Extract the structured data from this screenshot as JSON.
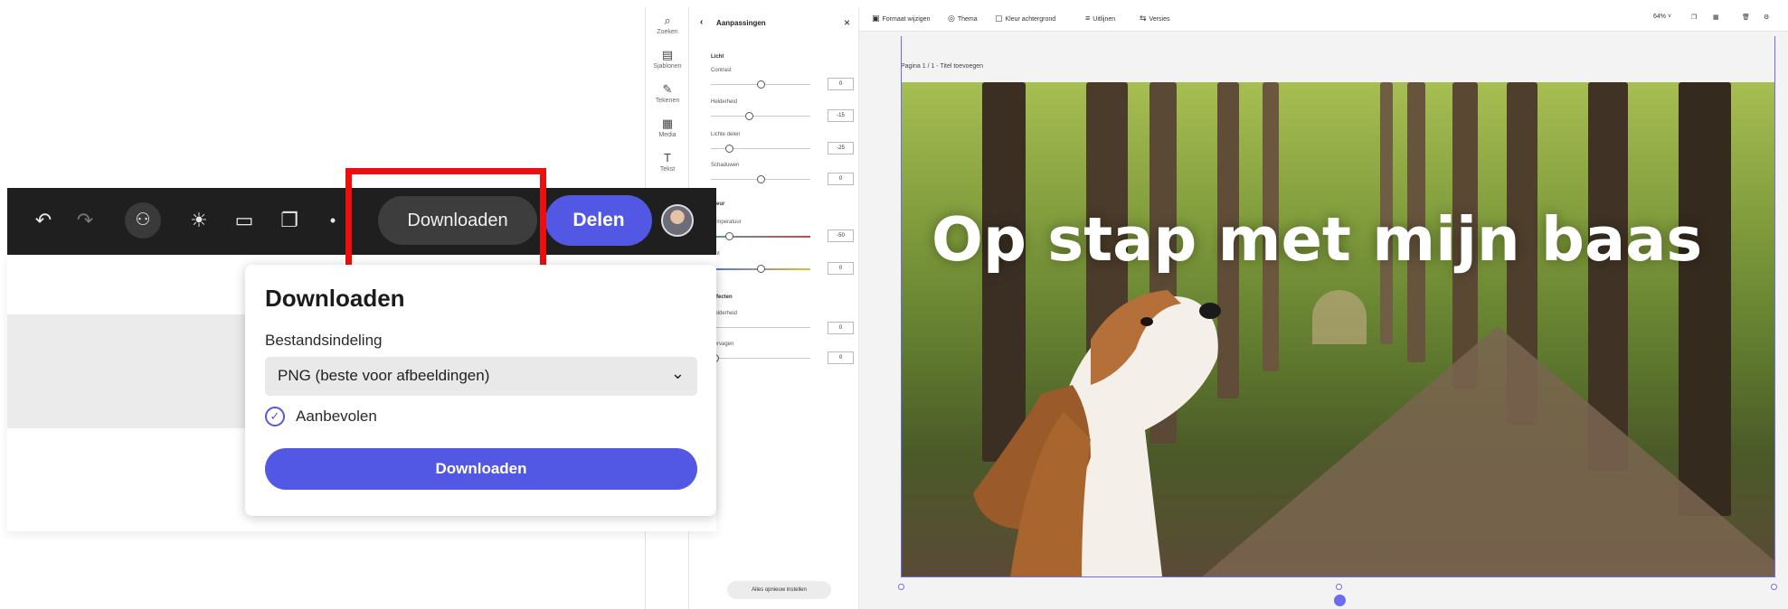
{
  "top_bar": {
    "download_label": "Downloaden",
    "share_label": "Delen"
  },
  "download_popup": {
    "title": "Downloaden",
    "format_label": "Bestandsindeling",
    "format_value": "PNG (beste voor afbeeldingen)",
    "recommended_label": "Aanbevolen",
    "download_button": "Downloaden"
  },
  "editor": {
    "rail": [
      {
        "icon": "search-icon",
        "glyph": "⌕",
        "label": "Zoeken"
      },
      {
        "icon": "templates-icon",
        "glyph": "▤",
        "label": "Sjablonen"
      },
      {
        "icon": "draw-icon",
        "glyph": "✎",
        "label": "Tekenen"
      },
      {
        "icon": "media-icon",
        "glyph": "▦",
        "label": "Media"
      },
      {
        "icon": "text-icon",
        "glyph": "T",
        "label": "Tekst"
      }
    ],
    "panel": {
      "title": "Aanpassingen",
      "section_light": "Licht",
      "contrast_label": "Contrast",
      "contrast_value": "0",
      "brightness_label": "Helderheid",
      "brightness_value": "-15",
      "highlights_label": "Lichte delen",
      "highlights_value": "-25",
      "shadows_label": "Schaduwen",
      "shadows_value": "0",
      "section_color": "Kleur",
      "temperature_label": "Temperatuur",
      "temperature_value": "-50",
      "tint_label": "Tint",
      "tint_value": "0",
      "section_effects": "Effecten",
      "clarity_label": "Helderheid",
      "clarity_value": "0",
      "blur_label": "Vervagen",
      "blur_value": "0",
      "reset_label": "Alles opnieuw instellen"
    },
    "toolbar": {
      "resize": "Formaat wijzigen",
      "theme": "Thema",
      "background": "Kleur achtergrond",
      "layout": "Uitlijnen",
      "versions": "Versies",
      "zoom": "64%"
    },
    "page_label": "Pagina 1 / 1 - Titel toevoegen",
    "canvas_title": "Op stap met mijn baas"
  },
  "colors": {
    "accent": "#5258e4",
    "toolbar_dark": "#1f1f1f",
    "highlight": "#ee0e0e"
  }
}
